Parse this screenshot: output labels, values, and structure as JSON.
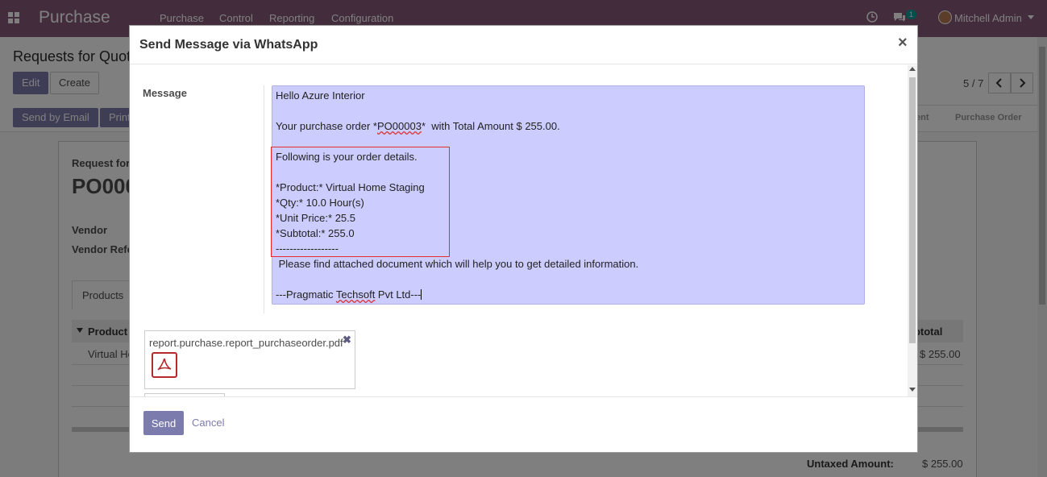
{
  "navbar": {
    "app_name": "Purchase",
    "menu": [
      "Purchase",
      "Control",
      "Reporting",
      "Configuration"
    ],
    "chat_count": "1",
    "user": "Mitchell Admin"
  },
  "control_panel": {
    "breadcrumb": "Requests for Quotation",
    "edit_label": "Edit",
    "create_label": "Create",
    "pager": "5 / 7",
    "send_email_label": "Send by Email",
    "print_label": "Print",
    "status_items": [
      "ent",
      "Purchase Order"
    ]
  },
  "sheet": {
    "doc_type": "Request for",
    "doc_name": "PO000",
    "vendor_label": "Vendor",
    "vendor_ref_label": "Vendor Refe",
    "tab_products": "Products",
    "col_product": "Product",
    "col_subtotal": "ubtotal",
    "row_product": "Virtual Ho",
    "row_subtotal": "$ 255.00",
    "untaxed_label": "Untaxed Amount:",
    "untaxed_value": "$ 255.00"
  },
  "modal": {
    "title": "Send Message via WhatsApp",
    "close_symbol": "×",
    "message_label": "Message",
    "lines": {
      "greeting": "Hello Azure Interior",
      "order_pre": "Your purchase order *",
      "order_ref": "PO00003",
      "order_post": "*  with Total Amount $ 255.00.",
      "details_heading": "Following is your order details.",
      "product": "*Product:* Virtual Home Staging",
      "qty": "*Qty:* 10.0 Hour(s)",
      "unit_price": "*Unit Price:* 25.5",
      "subtotal": "*Subtotal:* 255.0",
      "separator": "------------------",
      "attached_note": " Please find attached document which will help you to get detailed information.",
      "sign_pre": "---Pragmatic ",
      "sign_word": "Techsoft",
      "sign_post": " Pvt Ltd---"
    },
    "attachment_name": "report.purchase.report_purchaseorder.pdf",
    "attachment_remove": "✖",
    "send_label": "Send",
    "cancel_label": "Cancel"
  },
  "colors": {
    "navbar": "#875a7b",
    "primary": "#7c7bad",
    "editor_bg": "#ccccff",
    "highlight_border": "#e03030"
  },
  "icons": [
    "apps-grid-icon",
    "clock-icon",
    "chat-icon",
    "caret-down-icon",
    "chevron-left-icon",
    "chevron-right-icon",
    "close-icon",
    "pdf-file-icon",
    "remove-icon",
    "sort-caret-icon"
  ]
}
